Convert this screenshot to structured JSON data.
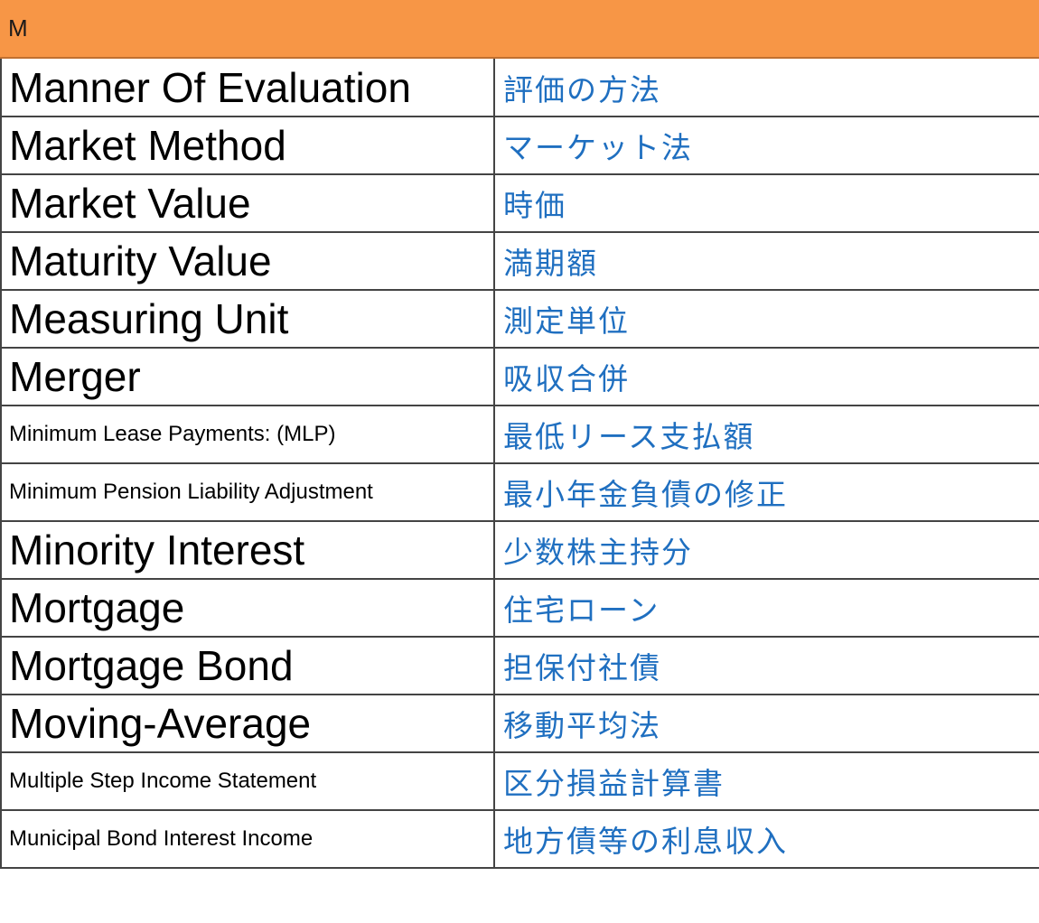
{
  "header": {
    "letter": "M"
  },
  "colors": {
    "header_bg": "#f79646",
    "japanese_text": "#1f6fc0",
    "english_text": "#000000",
    "grid": "#444444"
  },
  "rows": [
    {
      "en": "Manner Of Evaluation",
      "ja": "評価の方法",
      "size": "big"
    },
    {
      "en": "Market Method",
      "ja": "マーケット法",
      "size": "big"
    },
    {
      "en": "Market Value",
      "ja": "時価",
      "size": "big"
    },
    {
      "en": "Maturity Value",
      "ja": "満期額",
      "size": "big"
    },
    {
      "en": "Measuring Unit",
      "ja": "測定単位",
      "size": "big"
    },
    {
      "en": "Merger",
      "ja": "吸収合併",
      "size": "big"
    },
    {
      "en": "Minimum Lease Payments: (MLP)",
      "ja": "最低リース支払額",
      "size": "small"
    },
    {
      "en": "Minimum Pension Liability Adjustment",
      "ja": "最小年金負債の修正",
      "size": "small"
    },
    {
      "en": "Minority Interest",
      "ja": "少数株主持分",
      "size": "big"
    },
    {
      "en": "Mortgage",
      "ja": "住宅ローン",
      "size": "big"
    },
    {
      "en": "Mortgage Bond",
      "ja": "担保付社債",
      "size": "big"
    },
    {
      "en": "Moving-Average",
      "ja": "移動平均法",
      "size": "big"
    },
    {
      "en": "Multiple Step Income Statement",
      "ja": "区分損益計算書",
      "size": "small"
    },
    {
      "en": "Municipal Bond Interest Income",
      "ja": "地方債等の利息収入",
      "size": "small"
    }
  ]
}
